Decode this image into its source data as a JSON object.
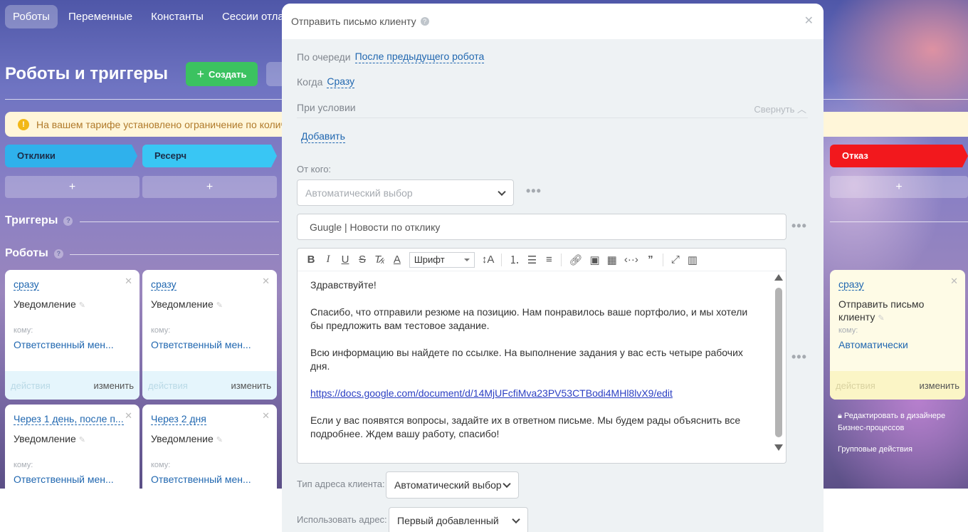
{
  "topnav": {
    "tabs": [
      "Роботы",
      "Переменные",
      "Константы",
      "Сессии отлад"
    ]
  },
  "page": {
    "title": "Роботы и триггеры",
    "create_label": "Создать"
  },
  "alert": {
    "text": "На вашем тарифе установлено ограничение по количес"
  },
  "stages": [
    {
      "label": "Отклики",
      "color": "#2fb1ec"
    },
    {
      "label": "Ресерч",
      "color": "#39c6f4"
    },
    {
      "label": "Отказ",
      "color": "#f2181d"
    }
  ],
  "stage_add_label": "+",
  "sections": {
    "triggers": "Триггеры",
    "robots": "Роботы"
  },
  "cards": [
    {
      "when": "сразу",
      "title": "Уведомление",
      "komu": "кому:",
      "whom": "Ответственный мен...",
      "actions": "действия",
      "change": "изменить"
    },
    {
      "when": "сразу",
      "title": "Уведомление",
      "komu": "кому:",
      "whom": "Ответственный мен...",
      "actions": "действия",
      "change": "изменить"
    },
    {
      "when": "Через 1 день, после п...",
      "title": "Уведомление",
      "komu": "кому:",
      "whom": "Ответственный мен..."
    },
    {
      "when": "Через 2 дня",
      "title": "Уведомление",
      "komu": "кому:",
      "whom": "Ответственный мен..."
    },
    {
      "when": "сразу",
      "title": "Отправить письмо клиенту",
      "komu": "кому:",
      "whom": "Автоматически",
      "actions": "действия",
      "change": "изменить"
    }
  ],
  "side_links": {
    "designer": "Редактировать в дизайнере",
    "bp": "Бизнес-процессов",
    "group": "Групповые действия"
  },
  "slider": {
    "title": "Отправить письмо клиенту",
    "queue_label": "По очереди",
    "queue_value": "После предыдущего робота",
    "when_label": "Когда",
    "when_value": "Сразу",
    "condition_label": "При условии",
    "collapse_label": "Свернуть",
    "add_label": "Добавить",
    "from_label": "От кого:",
    "from_placeholder": "Автоматический выбор",
    "subject_value": "Guugle | Новости по отклику",
    "font_label": "Шрифт",
    "body": {
      "p1": "Здравствуйте!",
      "p2": "Спасибо, что отправили резюме на позицию. Нам понравилось ваше портфолио, и мы хотели бы предложить вам тестовое задание.",
      "p3": "Всю информацию вы найдете по ссылке. На выполнение задания у вас есть четыре рабочих дня.",
      "link": "https://docs.google.com/document/d/14MjUFcfiMva23PV53CTBodi4MHl8lvX9/edit",
      "p4": "Если у вас появятся вопросы, задайте их в ответном письме. Мы будем рады объяснить все подробнее. Ждем вашу работу, спасибо!"
    },
    "address_type_label": "Тип адреса клиента:",
    "address_type_value": "Автоматический выбор",
    "use_address_label": "Использовать адрес:",
    "use_address_value": "Первый добавленный"
  }
}
